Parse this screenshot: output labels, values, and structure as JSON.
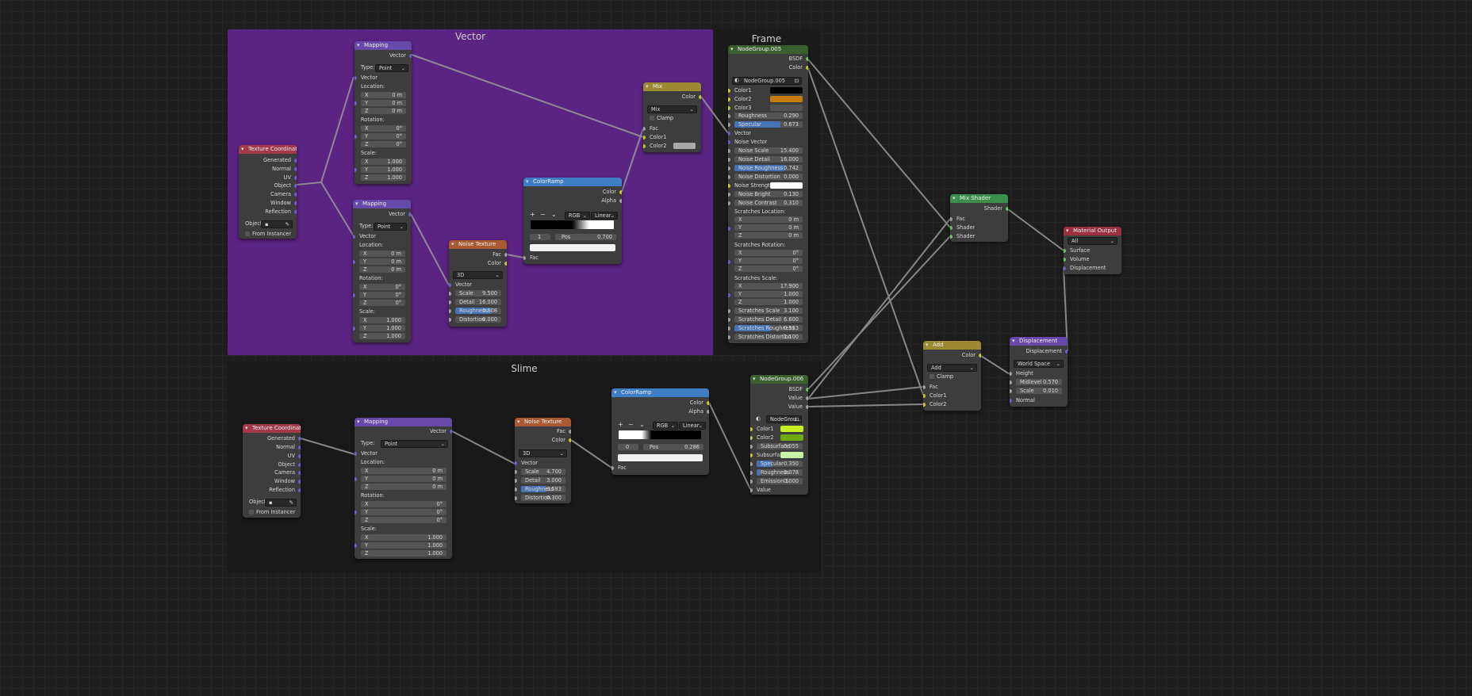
{
  "frames": {
    "vector": "Vector",
    "frame": "Frame",
    "slime": "Slime"
  },
  "colors": {
    "vector_frame": "#5b2382",
    "dark_frame": "#191919",
    "header_input": "#a33a4a",
    "header_vector": "#6649a8",
    "header_texture": "#a85a32",
    "header_converter": "#3f7ec4",
    "header_color": "#9b8a33",
    "header_group": "#3a5f2e",
    "header_shader": "#3c8f4a",
    "header_output": "#9a3040",
    "socket_vector": "#6363c7",
    "socket_color": "#c7c729",
    "socket_float": "#a1a1a1",
    "socket_shader": "#63c763"
  },
  "labels": {
    "texcoord": "Texture Coordinate",
    "generated": "Generated",
    "normal": "Normal",
    "uv": "UV",
    "object": "Object",
    "camera": "Camera",
    "window": "Window",
    "reflection": "Reflection",
    "object_colon": "Object:",
    "from_instancer": "From Instancer",
    "mapping": "Mapping",
    "vector": "Vector",
    "type": "Type:",
    "point": "Point",
    "location": "Location:",
    "rotation": "Rotation:",
    "scale_colon": "Scale:",
    "x": "X",
    "y": "Y",
    "z": "Z",
    "zero_m": "0 m",
    "zero_deg": "0°",
    "one": "1.000",
    "noise_texture": "Noise Texture",
    "fac": "Fac",
    "color": "Color",
    "dim3d": "3D",
    "scale": "Scale",
    "detail": "Detail",
    "roughness": "Roughness",
    "distortion": "Distortion",
    "color_ramp": "ColorRamp",
    "alpha": "Alpha",
    "rgb": "RGB",
    "linear": "Linear",
    "pos": "Pos",
    "mix": "Mix",
    "clamp": "Clamp",
    "color1": "Color1",
    "color2": "Color2",
    "color3": "Color3",
    "add": "Add",
    "mix_shader": "Mix Shader",
    "shader": "Shader",
    "material_output": "Material Output",
    "all": "All",
    "surface": "Surface",
    "volume": "Volume",
    "displacement": "Displacement",
    "world_space": "World Space",
    "height": "Height",
    "midlevel": "Midlevel",
    "normal_in": "Normal",
    "bsdf": "BSDF",
    "value": "Value",
    "plus": "+",
    "minus": "−",
    "chev": "⌄"
  },
  "values": {
    "v_noise_scale": "9.500",
    "v_noise_detail": "16.000",
    "v_noise_rough": "0.808",
    "v_noise_dist": "0.000",
    "v_ramp_index": "1",
    "v_ramp_pos": "0.700",
    "s_noise_scale": "4.700",
    "s_noise_detail": "3.000",
    "s_noise_rough": "0.583",
    "s_noise_dist": "0.300",
    "s_ramp_index": "0",
    "s_ramp_pos": "0.286",
    "disp_midlevel": "0.570",
    "disp_scale": "0.010"
  },
  "group005": {
    "title": "NodeGroup.005",
    "datablock": "NodeGroup.005",
    "roughness_label": "Roughness",
    "roughness": "0.290",
    "specular_label": "Specular",
    "specular": "0.673",
    "vector": "Vector",
    "noise_vector": "Noise Vector",
    "noise_scale_label": "Noise Scale",
    "noise_scale": "15.400",
    "noise_detail_label": "Noise Detail",
    "noise_detail": "16.000",
    "noise_roughness_label": "Noise Roughness",
    "noise_roughness": "0.742",
    "noise_distortion_label": "Noise Distortion",
    "noise_distortion": "0.000",
    "noise_strength": "Noise Strength",
    "noise_bright_label": "Noise Bright",
    "noise_bright": "0.130",
    "noise_contrast_label": "Noise Contrast",
    "noise_contrast": "0.310",
    "scratch_loc": "Scratches Location:",
    "scratch_rot": "Scratches Rotation:",
    "scratch_scale_hdr": "Scratches Scale:",
    "ss_x": "17.900",
    "ss_y": "1.000",
    "ss_z": "1.000",
    "scratches_scale_label": "Scratches Scale",
    "scratches_scale": "3.100",
    "scratches_detail_label": "Scratches Detail",
    "scratches_detail": "6.600",
    "scratches_rough_label": "Scratches Roughness",
    "scratches_rough": "0.533",
    "scratches_dist_label": "Scratches Distortion",
    "scratches_dist": "1.100"
  },
  "group006": {
    "title": "NodeGroup.006",
    "datablock": "NodeGrou...",
    "subsurface_label": "Subsurface",
    "subsurface": "0.055",
    "subsurfa_label": "Subsurfa...",
    "specular_label": "Specular",
    "specular": "0.350",
    "roughness_label": "Roughness",
    "roughness": "0.078",
    "emission_label": "Emission S",
    "emission": "0.000"
  }
}
